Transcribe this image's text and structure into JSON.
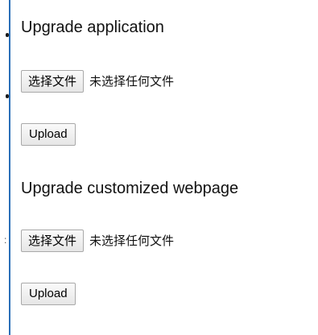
{
  "sections": [
    {
      "title": "Upgrade application",
      "choose_label": "选择文件",
      "file_status": "未选择任何文件",
      "upload_label": "Upload"
    },
    {
      "title": "Upgrade customized webpage",
      "choose_label": "选择文件",
      "file_status": "未选择任何文件",
      "upload_label": "Upload"
    }
  ],
  "colors": {
    "left_rule": "#2a6fb8",
    "button_border": "#a9a9a9"
  }
}
